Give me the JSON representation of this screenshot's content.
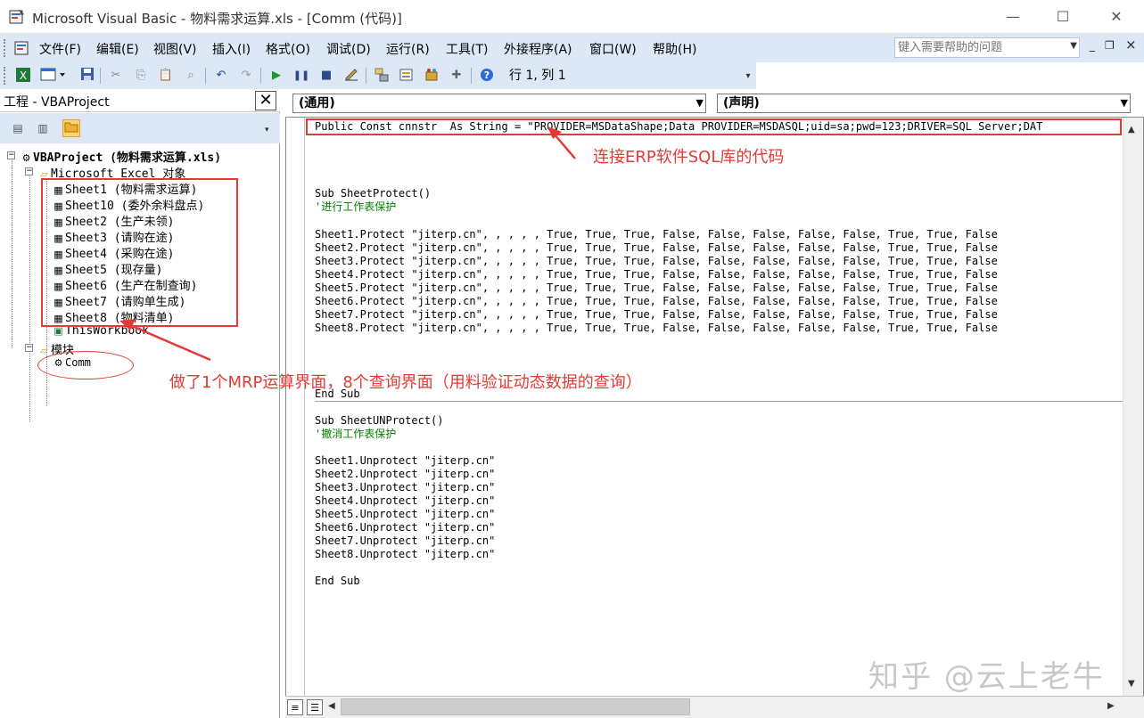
{
  "window": {
    "title": "Microsoft Visual Basic - 物料需求运算.xls - [Comm (代码)]",
    "minimize": "—",
    "maximize": "☐",
    "close": "✕"
  },
  "menu": {
    "items": [
      "文件(F)",
      "编辑(E)",
      "视图(V)",
      "插入(I)",
      "格式(O)",
      "调试(D)",
      "运行(R)",
      "工具(T)",
      "外接程序(A)",
      "窗口(W)",
      "帮助(H)"
    ],
    "help_placeholder": "键入需要帮助的问题",
    "mdi_min": "_",
    "mdi_restore": "❐",
    "mdi_close": "×"
  },
  "toolbar": {
    "position_readout": "行 1, 列 1",
    "icons": [
      "excel-icon",
      "insert-userform-icon",
      "save-icon",
      "cut-icon",
      "copy-icon",
      "paste-icon",
      "find-icon",
      "undo-icon",
      "redo-icon",
      "run-icon",
      "break-icon",
      "reset-icon",
      "design-mode-icon",
      "project-explorer-icon",
      "properties-icon",
      "object-browser-icon",
      "toolbox-icon",
      "help-icon"
    ]
  },
  "project": {
    "title": "工程 - VBAProject",
    "close": "✕",
    "tree": {
      "root": "VBAProject (物料需求运算.xls)",
      "folder_objects": "Microsoft Excel 对象",
      "sheets": [
        "Sheet1 (物料需求运算)",
        "Sheet10 (委外余料盘点)",
        "Sheet2 (生产未领)",
        "Sheet3 (请购在途)",
        "Sheet4 (采购在途)",
        "Sheet5 (现存量)",
        "Sheet6 (生产在制查询)",
        "Sheet7 (请购单生成)",
        "Sheet8 (物料清单)"
      ],
      "workbook": "ThisWorkbook",
      "folder_modules": "模块",
      "module": "Comm"
    }
  },
  "code": {
    "object_combo": "(通用)",
    "proc_combo": "(声明)",
    "lines": [
      {
        "t": "Public Const cnnstr  As String = \"PROVIDER=MSDataShape;Data PROVIDER=MSDASQL;uid=sa;pwd=123;DRIVER=SQL Server;DAT",
        "c": false
      },
      {
        "t": "Sub SheetProtect()",
        "c": false
      },
      {
        "t": "'进行工作表保护",
        "c": true
      },
      {
        "t": "Sheet1.Protect \"jiterp.cn\", , , , , True, True, True, False, False, False, False, False, True, True, False",
        "c": false
      },
      {
        "t": "Sheet2.Protect \"jiterp.cn\", , , , , True, True, True, False, False, False, False, False, True, True, False",
        "c": false
      },
      {
        "t": "Sheet3.Protect \"jiterp.cn\", , , , , True, True, True, False, False, False, False, False, True, True, False",
        "c": false
      },
      {
        "t": "Sheet4.Protect \"jiterp.cn\", , , , , True, True, True, False, False, False, False, False, True, True, False",
        "c": false
      },
      {
        "t": "Sheet5.Protect \"jiterp.cn\", , , , , True, True, True, False, False, False, False, False, True, True, False",
        "c": false
      },
      {
        "t": "Sheet6.Protect \"jiterp.cn\", , , , , True, True, True, False, False, False, False, False, True, True, False",
        "c": false
      },
      {
        "t": "Sheet7.Protect \"jiterp.cn\", , , , , True, True, True, False, False, False, False, False, True, True, False",
        "c": false
      },
      {
        "t": "Sheet8.Protect \"jiterp.cn\", , , , , True, True, True, False, False, False, False, False, True, True, False",
        "c": false
      },
      {
        "t": "End Sub",
        "c": false
      },
      {
        "t": "Sub SheetUNProtect()",
        "c": false
      },
      {
        "t": "'撤消工作表保护",
        "c": true
      },
      {
        "t": "Sheet1.Unprotect \"jiterp.cn\"",
        "c": false
      },
      {
        "t": "Sheet2.Unprotect \"jiterp.cn\"",
        "c": false
      },
      {
        "t": "Sheet3.Unprotect \"jiterp.cn\"",
        "c": false
      },
      {
        "t": "Sheet4.Unprotect \"jiterp.cn\"",
        "c": false
      },
      {
        "t": "Sheet5.Unprotect \"jiterp.cn\"",
        "c": false
      },
      {
        "t": "Sheet6.Unprotect \"jiterp.cn\"",
        "c": false
      },
      {
        "t": "Sheet7.Unprotect \"jiterp.cn\"",
        "c": false
      },
      {
        "t": "Sheet8.Unprotect \"jiterp.cn\"",
        "c": false
      },
      {
        "t": "End Sub",
        "c": false
      }
    ]
  },
  "annotations": {
    "erp_sql": "连接ERP软件SQL库的代码",
    "mrp": "做了1个MRP运算界面，8个查询界面（用料验证动态数据的查询）",
    "color": "#e53935"
  },
  "watermark": "知乎 @云上老牛"
}
